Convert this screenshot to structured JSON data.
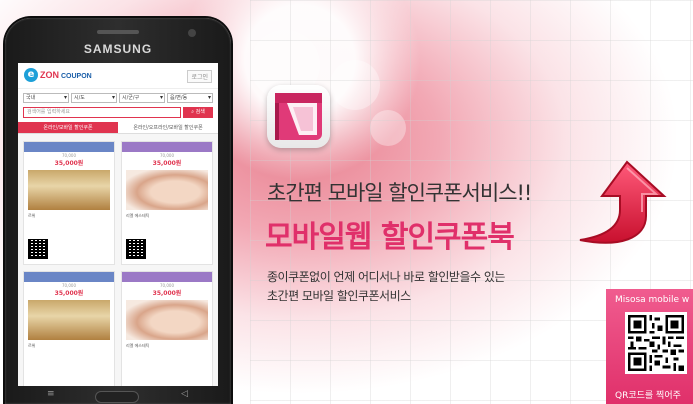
{
  "phone": {
    "brand": "SAMSUNG",
    "hw_back": "◁",
    "hw_menu": "≡"
  },
  "app": {
    "logo_letter": "e",
    "logo_text": "ZON",
    "logo_sub": "COUPON",
    "login": "로그인",
    "selects": [
      "국내",
      "시/도",
      "시/군/구",
      "읍/면/동"
    ],
    "search_placeholder": "검색어를 입력하세요",
    "search_button": "검색",
    "tabs": [
      "온라인/모바일 할인쿠폰",
      "온라인/오프라인/모바일 할인쿠폰"
    ],
    "cards": [
      {
        "price": "35,000원",
        "old": "70,000",
        "name": "르위",
        "kind": "room"
      },
      {
        "price": "35,000원",
        "old": "70,000",
        "name": "리엘 에스테틱",
        "kind": "spa"
      },
      {
        "price": "35,000원",
        "old": "70,000",
        "name": "르위",
        "kind": "room"
      },
      {
        "price": "35,000원",
        "old": "70,000",
        "name": "리엘 에스테틱",
        "kind": "spa"
      }
    ]
  },
  "promo": {
    "tagline": "초간편 모바일 할인쿠폰서비스!!",
    "headline": "모바일웹 할인쿠폰북",
    "desc_line1": "종이쿠폰없이 언제 어디서나 바로 할인받을수 있는",
    "desc_line2": "초간편 모바일 할인쿠폰서비스"
  },
  "qr": {
    "title": "Misosa mobile w",
    "footer": "QR코드를 찍어주"
  },
  "colors": {
    "accent": "#e0306a",
    "coupon_red": "#e0344f",
    "logo_blue": "#1da0d8"
  }
}
